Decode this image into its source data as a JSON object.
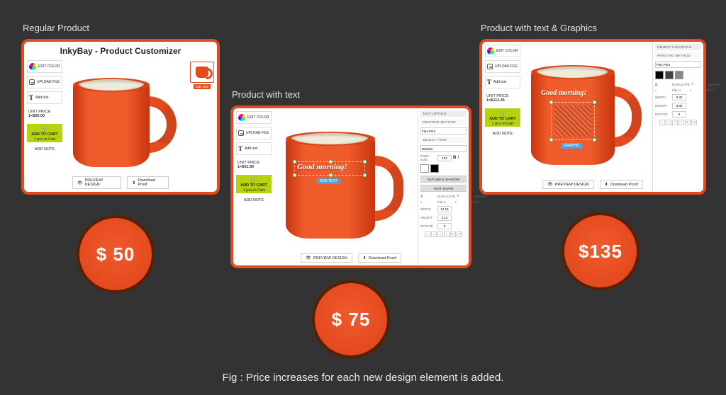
{
  "labels": {
    "regular": "Regular Product",
    "withText": "Product with text",
    "withGraphics": "Product with text & Graphics"
  },
  "app_title": "InkyBay - Product Customizer",
  "sidebar": {
    "edit_color": "EDIT COLOR",
    "upload": "UPLOAD FILE",
    "add_text": "Add text",
    "unit_price_lbl": "UNIT PRICE:",
    "add_to_cart": "ADD TO CART",
    "add_to_cart_sub": "1 pcs in Cart",
    "add_note": "ADD NOTE"
  },
  "prices": {
    "regular": "1×$50.00",
    "withText": "1×$61.90",
    "withGraphics": "1×$112.45"
  },
  "thumb_label": "Side One",
  "footer": {
    "preview": "PREVIEW DESIGN",
    "download": "Download Proof"
  },
  "overlay": {
    "text": "Good morning!",
    "add_text_btn": "ADD TEXT"
  },
  "rpanel": {
    "text_option": "TEXT OPTION",
    "printing_method": "PRINTING METHOD",
    "method_val": "Flex Print",
    "select_font": "SELECT FONT",
    "font_val": "Belinda",
    "font_size_lbl": "FONT SIZE",
    "font_size": "102",
    "outline": "OUTLINE & SHADOW",
    "text_shape": "TEXT SHAPE",
    "duplicate": "DUPLICATE",
    "remove": "Remove",
    "flip_lbl": "Flip H",
    "flip_v": "Flip V",
    "width_lbl": "WIDTH",
    "width": "14.15",
    "height_lbl": "HEIGHT",
    "height": "2.12",
    "rotate_lbl": "ROTATE",
    "rotate": "0",
    "object_controls": "OBJECT CONTROLS",
    "g_width": "9.30",
    "g_height": "8.30"
  },
  "circles": {
    "p1": "$ 50",
    "p2": "$ 75",
    "p3": "$135"
  },
  "caption": "Fig : Price increases for each new design element is added."
}
